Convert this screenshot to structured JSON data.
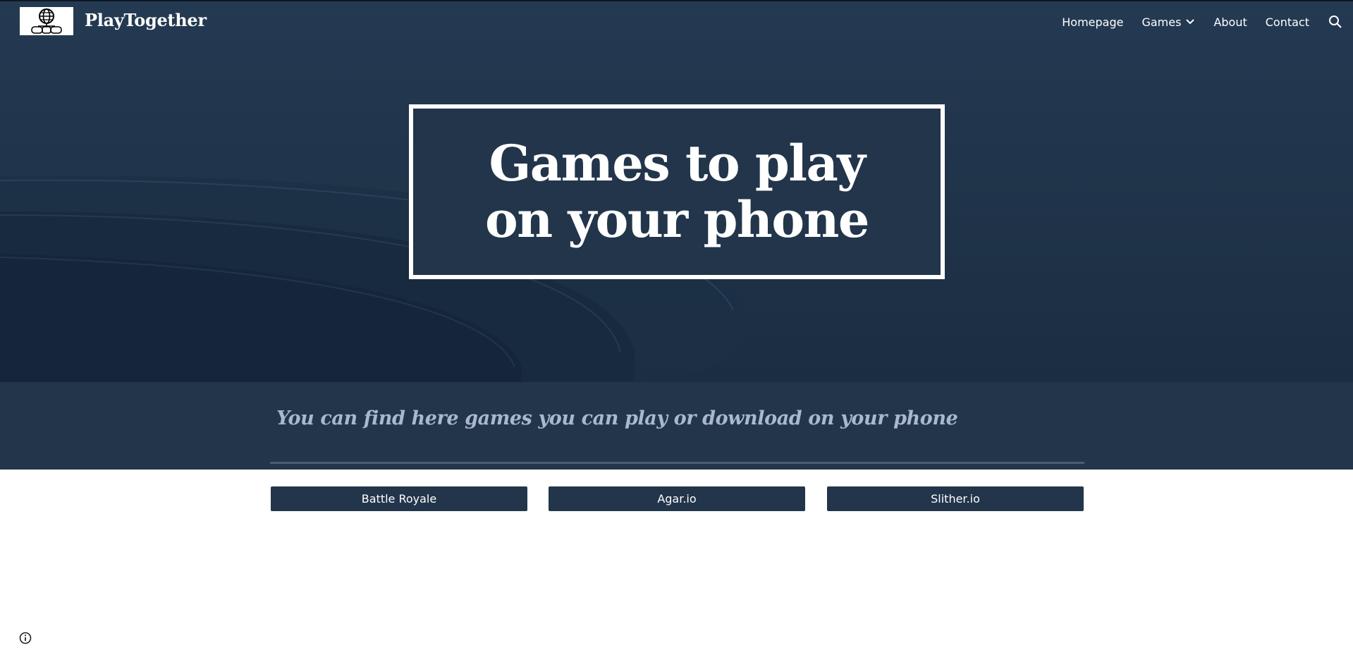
{
  "site": {
    "title": "PlayTogether"
  },
  "nav": {
    "items": [
      {
        "label": "Homepage"
      },
      {
        "label": "Games"
      },
      {
        "label": "About"
      },
      {
        "label": "Contact"
      }
    ]
  },
  "hero": {
    "title": "Games to play on your phone"
  },
  "subtitle": {
    "text": "You can find here games you can play or download on your phone"
  },
  "games": {
    "buttons": [
      {
        "label": "Battle Royale"
      },
      {
        "label": "Agar.io"
      },
      {
        "label": "Slither.io"
      }
    ]
  },
  "icons": {
    "logo": "globe-gamepad-logo",
    "games_dropdown": "chevron-down-icon",
    "search": "search-icon",
    "info": "info-icon"
  },
  "colors": {
    "navy": "#22354b",
    "subtitle_text": "#a9b9cc",
    "divider": "#4a5d73",
    "white": "#ffffff"
  }
}
